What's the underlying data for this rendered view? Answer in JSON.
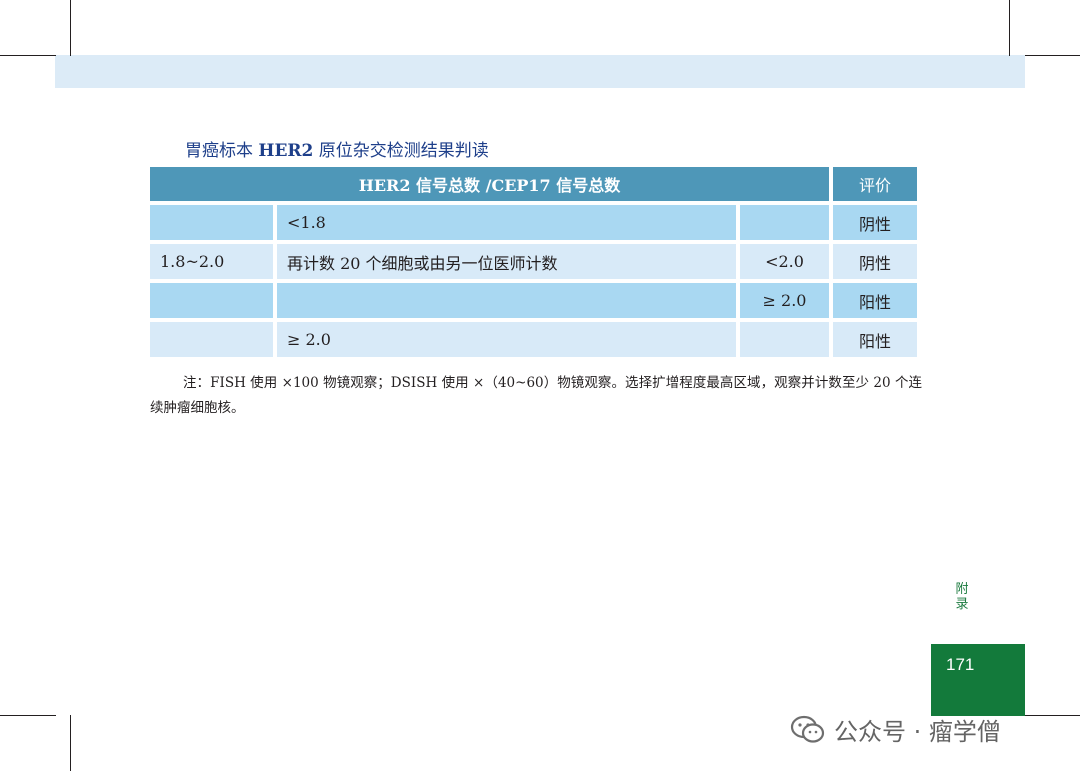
{
  "title": {
    "prefix": "胃癌标本 ",
    "bold": "HER2",
    "suffix": " 原位杂交检测结果判读"
  },
  "table": {
    "header_main": "HER2 信号总数 /CEP17 信号总数",
    "header_eval": "评价",
    "rows": [
      {
        "c1": "",
        "c2": "<1.8",
        "c3": "",
        "c4": "阴性"
      },
      {
        "c1": "1.8~2.0",
        "c2": "再计数 20 个细胞或由另一位医师计数",
        "c3": "<2.0",
        "c4": "阴性"
      },
      {
        "c1": "",
        "c2": "",
        "c3": "≥ 2.0",
        "c4": "阳性"
      },
      {
        "c1": "",
        "c2": "≥ 2.0",
        "c3": "",
        "c4": "阳性"
      }
    ]
  },
  "note": "注：FISH 使用 ×100 物镜观察；DSISH 使用 ×（40~60）物镜观察。选择扩增程度最高区域，观察并计数至少 20 个连续肿瘤细胞核。",
  "side_label": {
    "line1": "附",
    "line2": "录"
  },
  "page_number": "171",
  "watermark": "公众号 · 瘤学僧"
}
